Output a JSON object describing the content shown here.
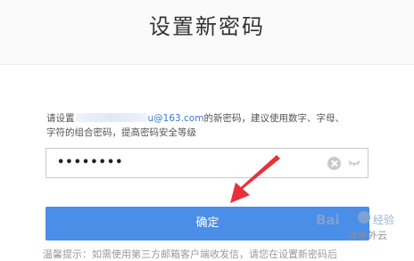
{
  "header": {
    "title": "设置新密码"
  },
  "description": {
    "prefix": "请设置",
    "email_domain": "u@163.com",
    "suffix_line1": "的新密码，建议使用数字、字母、",
    "line2": "字符的组合密码，提高密码安全等级"
  },
  "password_field": {
    "value": "••••••••"
  },
  "icons": {
    "clear": "clear-icon",
    "eye": "eye-closed-icon",
    "arrow": "red-arrow-annotation"
  },
  "confirm": {
    "label": "确定"
  },
  "tip": {
    "text": "温馨提示：如需使用第三方邮箱客户端收发信，请您在设置新密码后"
  },
  "watermark": {
    "logo": "Bai",
    "site": "经验",
    "author": "@世外云"
  },
  "colors": {
    "button": "#4a8ee8",
    "arrow": "#e8303a",
    "email_link": "#3a7bd5"
  }
}
